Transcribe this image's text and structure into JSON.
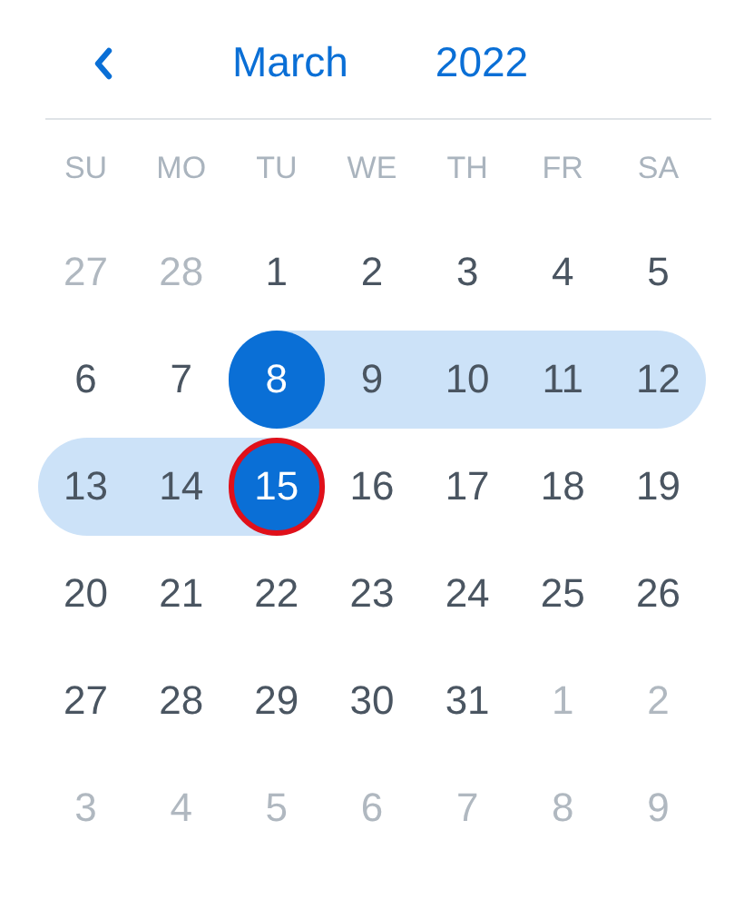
{
  "header": {
    "month": "March",
    "year": "2022"
  },
  "weekdays": [
    "SU",
    "MO",
    "TU",
    "WE",
    "TH",
    "FR",
    "SA"
  ],
  "weeks": [
    [
      {
        "label": "27",
        "muted": true,
        "selected": false,
        "in_range": false,
        "focused": false
      },
      {
        "label": "28",
        "muted": true,
        "selected": false,
        "in_range": false,
        "focused": false
      },
      {
        "label": "1",
        "muted": false,
        "selected": false,
        "in_range": false,
        "focused": false
      },
      {
        "label": "2",
        "muted": false,
        "selected": false,
        "in_range": false,
        "focused": false
      },
      {
        "label": "3",
        "muted": false,
        "selected": false,
        "in_range": false,
        "focused": false
      },
      {
        "label": "4",
        "muted": false,
        "selected": false,
        "in_range": false,
        "focused": false
      },
      {
        "label": "5",
        "muted": false,
        "selected": false,
        "in_range": false,
        "focused": false
      }
    ],
    [
      {
        "label": "6",
        "muted": false,
        "selected": false,
        "in_range": false,
        "focused": false
      },
      {
        "label": "7",
        "muted": false,
        "selected": false,
        "in_range": false,
        "focused": false
      },
      {
        "label": "8",
        "muted": false,
        "selected": true,
        "in_range": true,
        "focused": false
      },
      {
        "label": "9",
        "muted": false,
        "selected": false,
        "in_range": true,
        "focused": false
      },
      {
        "label": "10",
        "muted": false,
        "selected": false,
        "in_range": true,
        "focused": false
      },
      {
        "label": "11",
        "muted": false,
        "selected": false,
        "in_range": true,
        "focused": false
      },
      {
        "label": "12",
        "muted": false,
        "selected": false,
        "in_range": true,
        "focused": false
      }
    ],
    [
      {
        "label": "13",
        "muted": false,
        "selected": false,
        "in_range": true,
        "focused": false
      },
      {
        "label": "14",
        "muted": false,
        "selected": false,
        "in_range": true,
        "focused": false
      },
      {
        "label": "15",
        "muted": false,
        "selected": true,
        "in_range": true,
        "focused": true
      },
      {
        "label": "16",
        "muted": false,
        "selected": false,
        "in_range": false,
        "focused": false
      },
      {
        "label": "17",
        "muted": false,
        "selected": false,
        "in_range": false,
        "focused": false
      },
      {
        "label": "18",
        "muted": false,
        "selected": false,
        "in_range": false,
        "focused": false
      },
      {
        "label": "19",
        "muted": false,
        "selected": false,
        "in_range": false,
        "focused": false
      }
    ],
    [
      {
        "label": "20",
        "muted": false,
        "selected": false,
        "in_range": false,
        "focused": false
      },
      {
        "label": "21",
        "muted": false,
        "selected": false,
        "in_range": false,
        "focused": false
      },
      {
        "label": "22",
        "muted": false,
        "selected": false,
        "in_range": false,
        "focused": false
      },
      {
        "label": "23",
        "muted": false,
        "selected": false,
        "in_range": false,
        "focused": false
      },
      {
        "label": "24",
        "muted": false,
        "selected": false,
        "in_range": false,
        "focused": false
      },
      {
        "label": "25",
        "muted": false,
        "selected": false,
        "in_range": false,
        "focused": false
      },
      {
        "label": "26",
        "muted": false,
        "selected": false,
        "in_range": false,
        "focused": false
      }
    ],
    [
      {
        "label": "27",
        "muted": false,
        "selected": false,
        "in_range": false,
        "focused": false
      },
      {
        "label": "28",
        "muted": false,
        "selected": false,
        "in_range": false,
        "focused": false
      },
      {
        "label": "29",
        "muted": false,
        "selected": false,
        "in_range": false,
        "focused": false
      },
      {
        "label": "30",
        "muted": false,
        "selected": false,
        "in_range": false,
        "focused": false
      },
      {
        "label": "31",
        "muted": false,
        "selected": false,
        "in_range": false,
        "focused": false
      },
      {
        "label": "1",
        "muted": true,
        "selected": false,
        "in_range": false,
        "focused": false
      },
      {
        "label": "2",
        "muted": true,
        "selected": false,
        "in_range": false,
        "focused": false
      }
    ],
    [
      {
        "label": "3",
        "muted": true,
        "selected": false,
        "in_range": false,
        "focused": false
      },
      {
        "label": "4",
        "muted": true,
        "selected": false,
        "in_range": false,
        "focused": false
      },
      {
        "label": "5",
        "muted": true,
        "selected": false,
        "in_range": false,
        "focused": false
      },
      {
        "label": "6",
        "muted": true,
        "selected": false,
        "in_range": false,
        "focused": false
      },
      {
        "label": "7",
        "muted": true,
        "selected": false,
        "in_range": false,
        "focused": false
      },
      {
        "label": "8",
        "muted": true,
        "selected": false,
        "in_range": false,
        "focused": false
      },
      {
        "label": "9",
        "muted": true,
        "selected": false,
        "in_range": false,
        "focused": false
      }
    ]
  ]
}
